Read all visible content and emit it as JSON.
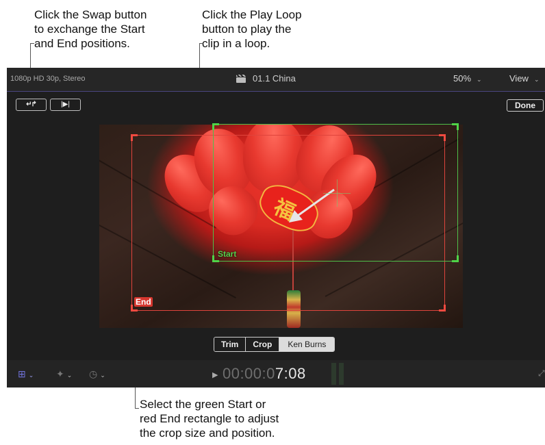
{
  "callouts": {
    "swap": [
      "Click the Swap button",
      "to exchange the Start",
      "and End positions."
    ],
    "loop": [
      "Click the Play Loop",
      "button to play the",
      "clip in a loop."
    ],
    "rect": [
      "Select the green Start or",
      "red End rectangle to adjust",
      "the crop size and position."
    ]
  },
  "topbar": {
    "format": "1080p HD 30p, Stereo",
    "clip_name": "01.1 China",
    "zoom": "50%",
    "view": "View"
  },
  "buttons": {
    "swap_icon": "swap-arrows-icon",
    "loop_icon": "play-loop-icon",
    "done": "Done"
  },
  "viewer": {
    "start_label": "Start",
    "end_label": "End",
    "start_color": "#4fbf4a",
    "end_color": "#e0443c",
    "charm_glyph": "福"
  },
  "modes": {
    "items": [
      "Trim",
      "Crop",
      "Ken Burns"
    ],
    "selected": "Ken Burns"
  },
  "bottombar": {
    "timecode_dim": "00:00:0",
    "timecode_bright": "7:08"
  }
}
